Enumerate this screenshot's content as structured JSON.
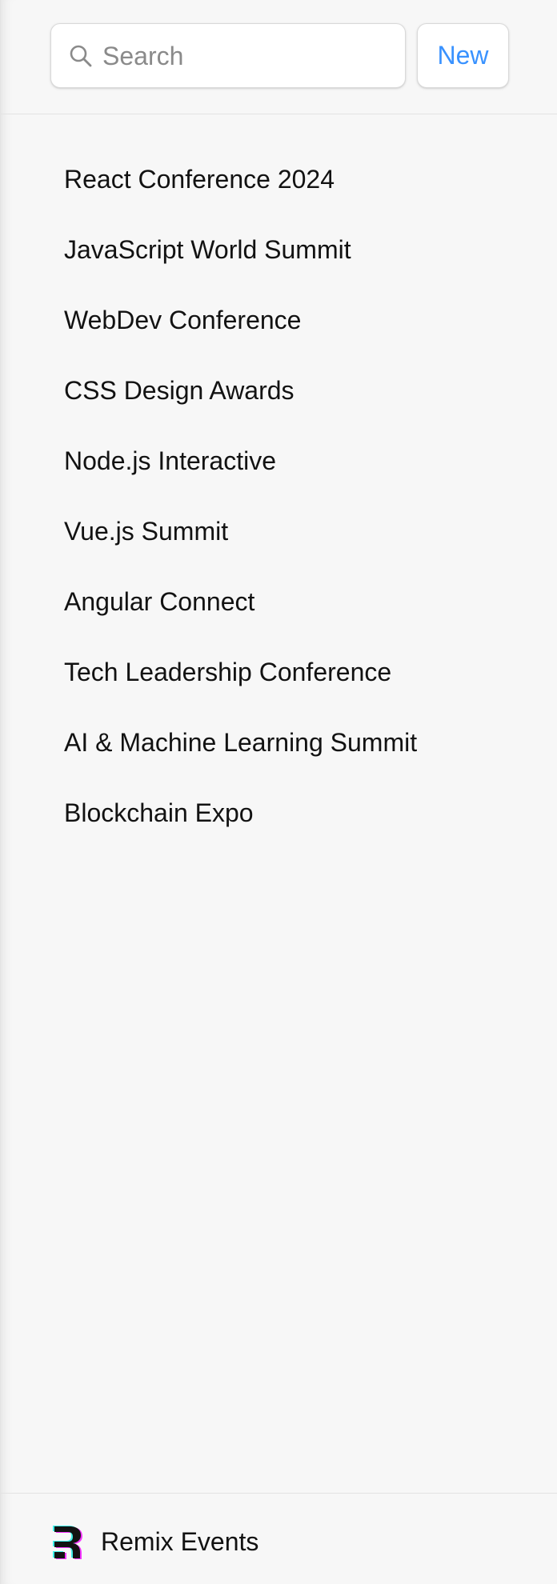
{
  "search": {
    "placeholder": "Search",
    "icon": "search-icon"
  },
  "toolbar": {
    "new_label": "New",
    "accent_color": "#3992ff"
  },
  "events": [
    "React Conference 2024",
    "JavaScript World Summit",
    "WebDev Conference",
    "CSS Design Awards",
    "Node.js Interactive",
    "Vue.js Summit",
    "Angular Connect",
    "Tech Leadership Conference",
    "AI & Machine Learning Summit",
    "Blockchain Expo"
  ],
  "footer": {
    "app_name": "Remix Events",
    "logo_icon": "remix-logo-icon"
  }
}
